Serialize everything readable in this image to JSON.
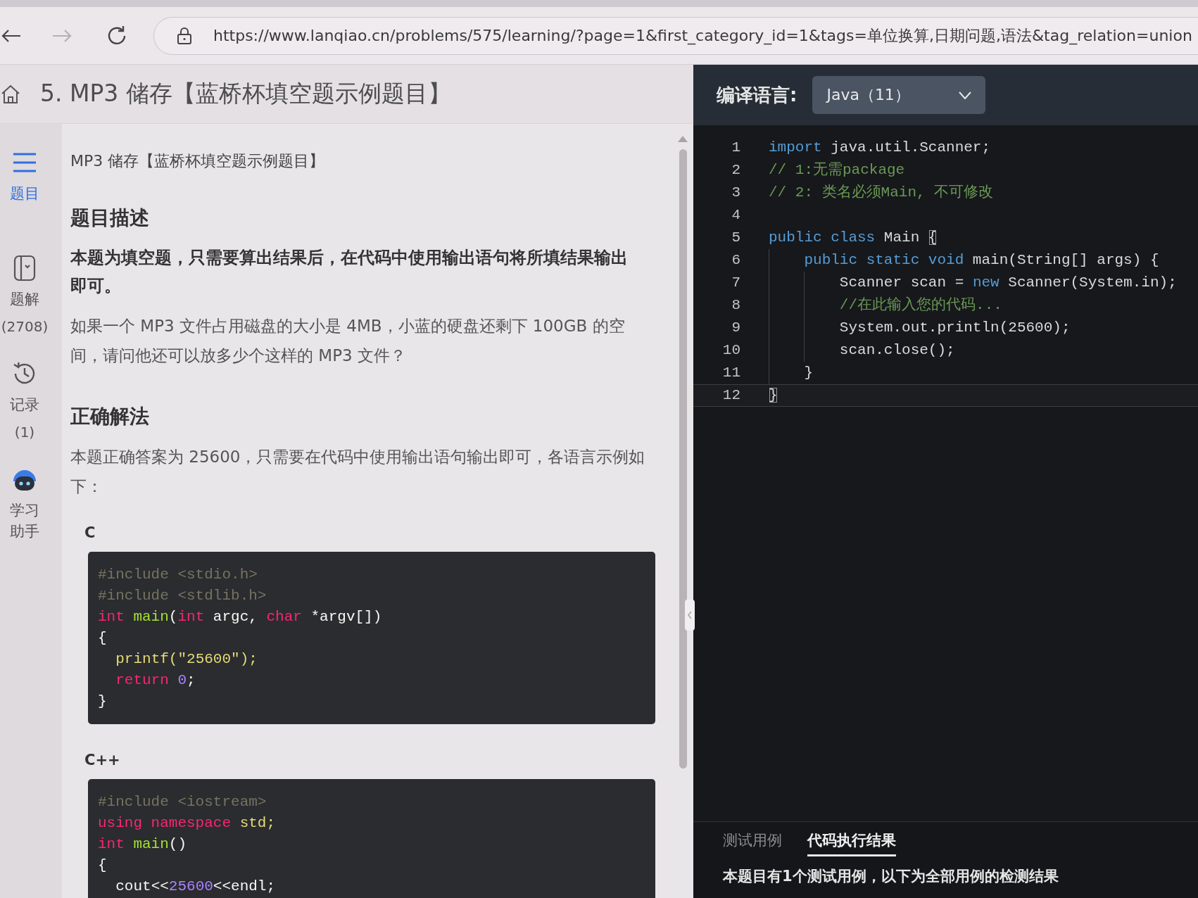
{
  "browser": {
    "back_enabled": true,
    "forward_enabled": false,
    "url": "https://www.lanqiao.cn/problems/575/learning/?page=1&first_category_id=1&tags=单位换算,日期问题,语法&tag_relation=union"
  },
  "problem": {
    "title": "5. MP3 储存【蓝桥杯填空题示例题目】"
  },
  "sidebar": {
    "items": [
      {
        "kind": "problem",
        "label": "题目",
        "selected": true
      },
      {
        "kind": "solution",
        "label": "题解",
        "count": "(2708)",
        "selected": false
      },
      {
        "kind": "record",
        "label": "记录",
        "count": "(1)",
        "selected": false
      },
      {
        "kind": "assistant",
        "label": "学习助手",
        "selected": false
      }
    ]
  },
  "content": {
    "subtitle": "MP3 储存【蓝桥杯填空题示例题目】",
    "sections": [
      {
        "heading": "题目描述",
        "paragraphs": [
          {
            "kind": "notice",
            "text": "本题为填空题，只需要算出结果后，在代码中使用输出语句将所填结果输出即可。"
          },
          {
            "kind": "body",
            "text": "如果一个 MP3 文件占用磁盘的大小是 4MB，小蓝的硬盘还剩下 100GB 的空间，请问他还可以放多少个这样的 MP3 文件？"
          }
        ]
      },
      {
        "heading": "正确解法",
        "paragraphs": [
          {
            "kind": "body",
            "text": "本题正确答案为 25600，只需要在代码中使用输出语句输出即可，各语言示例如下："
          }
        ],
        "examples": [
          {
            "language": "C",
            "lines": [
              [
                {
                  "text": "#include <stdio.h>",
                  "kind": "preproc"
                }
              ],
              [
                {
                  "text": "#include <stdlib.h>",
                  "kind": "preproc"
                }
              ],
              [
                {
                  "text": "int",
                  "kind": "keyword"
                },
                {
                  "text": " main",
                  "kind": "function"
                },
                {
                  "text": "(",
                  "kind": "plain"
                },
                {
                  "text": "int",
                  "kind": "keyword"
                },
                {
                  "text": " argc, ",
                  "kind": "plain"
                },
                {
                  "text": "char",
                  "kind": "keyword"
                },
                {
                  "text": " *argv[])",
                  "kind": "plain"
                }
              ],
              [
                {
                  "text": "{",
                  "kind": "plain"
                }
              ],
              [
                {
                  "text": "  printf(",
                  "kind": "builtin"
                },
                {
                  "text": "\"25600\"",
                  "kind": "string"
                },
                {
                  "text": ");",
                  "kind": "builtin"
                }
              ],
              [
                {
                  "text": "  return",
                  "kind": "keyword"
                },
                {
                  "text": " 0",
                  "kind": "number"
                },
                {
                  "text": ";",
                  "kind": "plain"
                }
              ],
              [
                {
                  "text": "}",
                  "kind": "plain"
                }
              ]
            ]
          },
          {
            "language": "C++",
            "lines": [
              [
                {
                  "text": "#include <iostream>",
                  "kind": "preproc"
                }
              ],
              [
                {
                  "text": "using namespace",
                  "kind": "keyword"
                },
                {
                  "text": " std;",
                  "kind": "builtin"
                }
              ],
              [
                {
                  "text": "int",
                  "kind": "keyword"
                },
                {
                  "text": " main",
                  "kind": "function"
                },
                {
                  "text": "()",
                  "kind": "plain"
                }
              ],
              [
                {
                  "text": "{",
                  "kind": "plain"
                }
              ],
              [
                {
                  "text": "  cout<<",
                  "kind": "plain"
                },
                {
                  "text": "25600",
                  "kind": "number"
                },
                {
                  "text": "<<endl;",
                  "kind": "plain"
                }
              ]
            ]
          }
        ]
      }
    ]
  },
  "editor": {
    "label": "编译语言:",
    "language": "Java（11）",
    "lines": [
      {
        "num": "1",
        "current": false,
        "tokens": [
          {
            "text": "import",
            "kind": "keyword"
          },
          {
            "text": " java.util.Scanner;",
            "kind": "plain"
          }
        ]
      },
      {
        "num": "2",
        "current": false,
        "tokens": [
          {
            "text": "// 1:无需package",
            "kind": "comment"
          }
        ]
      },
      {
        "num": "3",
        "current": false,
        "tokens": [
          {
            "text": "// 2: 类名必须Main, 不可修改",
            "kind": "comment"
          }
        ]
      },
      {
        "num": "4",
        "current": false
      },
      {
        "num": "5",
        "current": false,
        "tokens": [
          {
            "text": "public class",
            "kind": "keyword"
          },
          {
            "text": " Main ",
            "kind": "plain"
          },
          {
            "text": "{",
            "kind": "bracket"
          }
        ]
      },
      {
        "num": "6",
        "current": false,
        "tokens": [
          {
            "text": "    public static void",
            "kind": "keyword"
          },
          {
            "text": " main(String[] args) {",
            "kind": "plain"
          }
        ]
      },
      {
        "num": "7",
        "current": false,
        "tokens": [
          {
            "text": "        Scanner scan = ",
            "kind": "plain"
          },
          {
            "text": "new",
            "kind": "keyword"
          },
          {
            "text": " Scanner(System.in);",
            "kind": "plain"
          }
        ]
      },
      {
        "num": "8",
        "current": false,
        "tokens": [
          {
            "text": "        //在此输入您的代码...",
            "kind": "comment"
          }
        ]
      },
      {
        "num": "9",
        "current": false,
        "tokens": [
          {
            "text": "        System.out.println(25600);",
            "kind": "plain"
          }
        ]
      },
      {
        "num": "10",
        "current": false,
        "tokens": [
          {
            "text": "        scan.close();",
            "kind": "plain"
          }
        ]
      },
      {
        "num": "11",
        "current": false,
        "tokens": [
          {
            "text": "    }",
            "kind": "plain"
          }
        ]
      },
      {
        "num": "12",
        "current": true,
        "tokens": [
          {
            "text": "}",
            "kind": "bracket"
          }
        ]
      }
    ]
  },
  "result": {
    "tabs": [
      {
        "label": "测试用例",
        "selected": false
      },
      {
        "label": "代码执行结果",
        "selected": true
      }
    ],
    "message": "本题目有1个测试用例，以下为全部用例的检测结果"
  }
}
